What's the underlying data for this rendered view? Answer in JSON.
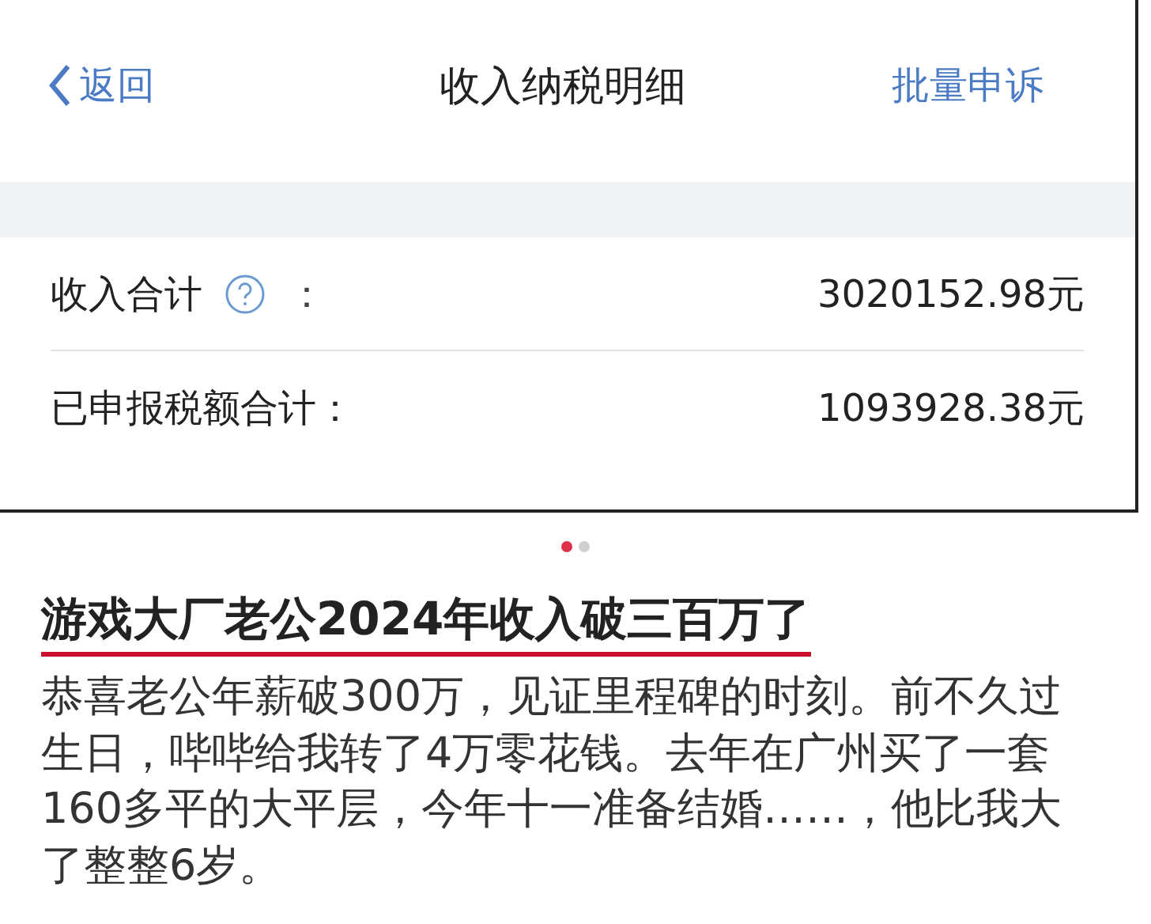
{
  "embedded_screenshot": {
    "nav_bar": {
      "back": "返回",
      "title": "收入纳税明细",
      "action": "批量申诉"
    },
    "rows": [
      {
        "label": "收入合计",
        "help_icon": true,
        "colon": "：",
        "value": "3020152.98元"
      },
      {
        "label": "已申报税额合计：",
        "help_icon": false,
        "value": "1093928.38元"
      }
    ]
  },
  "carousel_dots": [
    {
      "selected": true
    },
    {
      "selected": false
    }
  ],
  "post": {
    "title": "游戏大厂老公2024年收入破三百万了",
    "body": "恭喜老公年薪破300万，见证里程碑的时刻。前不久过生日，哔哔给我转了4万零花钱。去年在广州买了一套160多平的大平层，今年十一准备结婚……，他比我大了整整6岁。"
  }
}
